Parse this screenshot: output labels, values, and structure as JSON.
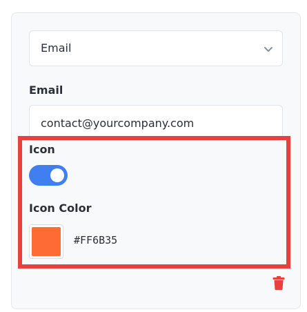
{
  "select": {
    "value": "Email"
  },
  "email": {
    "label": "Email",
    "value": "contact@yourcompany.com"
  },
  "icon": {
    "label": "Icon",
    "enabled": true
  },
  "icon_color": {
    "label": "Icon Color",
    "value": "#FF6B35"
  },
  "colors": {
    "accent": "#3F7FF0",
    "swatch": "#FF6B35",
    "delete": "#E8403F",
    "highlight": "#E8403F"
  },
  "icons": {
    "select": "chevron-down-icon",
    "delete": "trash-icon"
  }
}
